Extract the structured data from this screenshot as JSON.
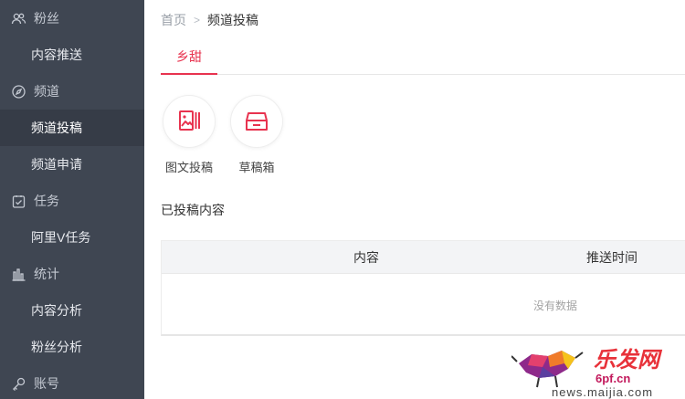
{
  "sidebar": {
    "items": [
      {
        "label": "粉丝",
        "type": "section",
        "icon": "users-icon"
      },
      {
        "label": "内容推送",
        "type": "sub"
      },
      {
        "label": "频道",
        "type": "section",
        "icon": "compass-icon"
      },
      {
        "label": "频道投稿",
        "type": "sub",
        "active": true
      },
      {
        "label": "频道申请",
        "type": "sub"
      },
      {
        "label": "任务",
        "type": "section",
        "icon": "task-check-icon"
      },
      {
        "label": "阿里V任务",
        "type": "sub"
      },
      {
        "label": "统计",
        "type": "section",
        "icon": "bar-chart-icon"
      },
      {
        "label": "内容分析",
        "type": "sub"
      },
      {
        "label": "粉丝分析",
        "type": "sub"
      },
      {
        "label": "账号",
        "type": "section",
        "icon": "key-icon"
      }
    ]
  },
  "breadcrumb": {
    "home": "首页",
    "current": "频道投稿"
  },
  "tabs": [
    {
      "label": "乡甜",
      "active": true
    }
  ],
  "actions": [
    {
      "label": "图文投稿",
      "icon": "image-text-post-icon"
    },
    {
      "label": "草稿箱",
      "icon": "draft-box-icon"
    }
  ],
  "section_title": "已投稿内容",
  "table": {
    "columns": [
      "内容",
      "推送时间"
    ],
    "empty_text": "没有数据"
  },
  "watermark": {
    "title": "乐发网",
    "site": "6pf.cn",
    "url": "news.maijia.com"
  },
  "colors": {
    "accent": "#e8334f",
    "sidebar": "#3f4652",
    "sidebar_active": "#363c47"
  }
}
